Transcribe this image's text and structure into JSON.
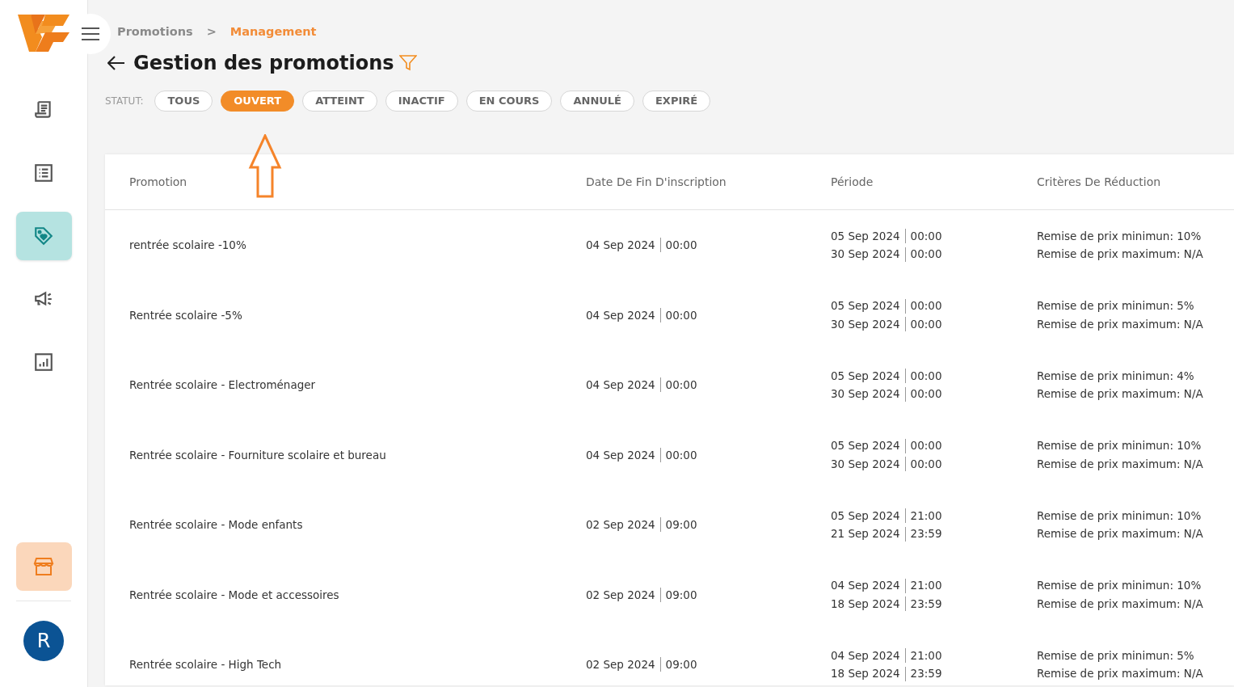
{
  "sidebar": {
    "items": [
      {
        "kind": "receipt",
        "selected": false
      },
      {
        "kind": "list",
        "selected": false
      },
      {
        "kind": "tag",
        "selected": true
      },
      {
        "kind": "megaphone",
        "selected": false
      },
      {
        "kind": "chart",
        "selected": false
      }
    ],
    "store_button": {
      "selected": true
    },
    "avatar": {
      "initial": "R"
    }
  },
  "breadcrumb": {
    "separator": ">",
    "items": [
      {
        "label": "Promotions",
        "selected": false
      },
      {
        "label": "Management",
        "selected": true
      }
    ]
  },
  "title": "Gestion des promotions",
  "status_filter": {
    "label": "STATUT:",
    "options": [
      {
        "label": "TOUS",
        "selected": false
      },
      {
        "label": "OUVERT",
        "selected": true
      },
      {
        "label": "ATTEINT",
        "selected": false
      },
      {
        "label": "INACTIF",
        "selected": false
      },
      {
        "label": "EN COURS",
        "selected": false
      },
      {
        "label": "ANNULÉ",
        "selected": false
      },
      {
        "label": "EXPIRÉ",
        "selected": false
      }
    ]
  },
  "table": {
    "columns": [
      "Promotion",
      "Date De Fin D'inscription",
      "Période",
      "Critères De Réduction"
    ],
    "rows": [
      {
        "promotion": "rentrée scolaire -10%",
        "registration_end": {
          "date": "04 Sep 2024",
          "time": "00:00"
        },
        "period": [
          {
            "date": "05 Sep 2024",
            "time": "00:00"
          },
          {
            "date": "30 Sep 2024",
            "time": "00:00"
          }
        ],
        "criteria": [
          "Remise de prix minimun: 10%",
          "Remise de prix maximum: N/A"
        ]
      },
      {
        "promotion": "Rentrée scolaire -5%",
        "registration_end": {
          "date": "04 Sep 2024",
          "time": "00:00"
        },
        "period": [
          {
            "date": "05 Sep 2024",
            "time": "00:00"
          },
          {
            "date": "30 Sep 2024",
            "time": "00:00"
          }
        ],
        "criteria": [
          "Remise de prix minimun: 5%",
          "Remise de prix maximum: N/A"
        ]
      },
      {
        "promotion": "Rentrée scolaire - Electroménager",
        "registration_end": {
          "date": "04 Sep 2024",
          "time": "00:00"
        },
        "period": [
          {
            "date": "05 Sep 2024",
            "time": "00:00"
          },
          {
            "date": "30 Sep 2024",
            "time": "00:00"
          }
        ],
        "criteria": [
          "Remise de prix minimun: 4%",
          "Remise de prix maximum: N/A"
        ]
      },
      {
        "promotion": "Rentrée scolaire - Fourniture scolaire et bureau",
        "registration_end": {
          "date": "04 Sep 2024",
          "time": "00:00"
        },
        "period": [
          {
            "date": "05 Sep 2024",
            "time": "00:00"
          },
          {
            "date": "30 Sep 2024",
            "time": "00:00"
          }
        ],
        "criteria": [
          "Remise de prix minimun: 10%",
          "Remise de prix maximum: N/A"
        ]
      },
      {
        "promotion": "Rentrée scolaire - Mode enfants",
        "registration_end": {
          "date": "02 Sep 2024",
          "time": "09:00"
        },
        "period": [
          {
            "date": "05 Sep 2024",
            "time": "21:00"
          },
          {
            "date": "21 Sep 2024",
            "time": "23:59"
          }
        ],
        "criteria": [
          "Remise de prix minimun: 10%",
          "Remise de prix maximum: N/A"
        ]
      },
      {
        "promotion": "Rentrée scolaire - Mode et accessoires",
        "registration_end": {
          "date": "02 Sep 2024",
          "time": "09:00"
        },
        "period": [
          {
            "date": "04 Sep 2024",
            "time": "21:00"
          },
          {
            "date": "18 Sep 2024",
            "time": "23:59"
          }
        ],
        "criteria": [
          "Remise de prix minimun: 10%",
          "Remise de prix maximum: N/A"
        ]
      },
      {
        "promotion": "Rentrée scolaire - High Tech",
        "registration_end": {
          "date": "02 Sep 2024",
          "time": "09:00"
        },
        "period": [
          {
            "date": "04 Sep 2024",
            "time": "21:00"
          },
          {
            "date": "18 Sep 2024",
            "time": "23:59"
          }
        ],
        "criteria": [
          "Remise de prix minimun: 5%",
          "Remise de prix maximum: N/A"
        ]
      }
    ]
  }
}
